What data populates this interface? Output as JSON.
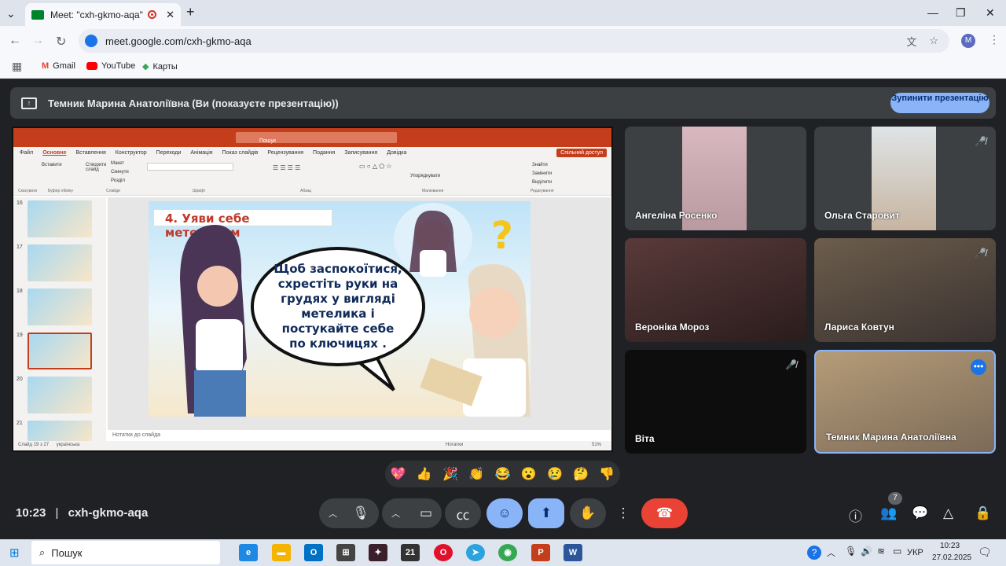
{
  "browser": {
    "tab_title": "Meet: \"cxh-gkmo-aqa\"",
    "new_tab": "+",
    "url": "meet.google.com/cxh-gkmo-aqa",
    "profile": "M",
    "bookmarks": [
      {
        "label": "Gmail"
      },
      {
        "label": "YouTube"
      },
      {
        "label": "Карты"
      }
    ]
  },
  "presenting": {
    "banner": "Темник Марина Анатоліївна (Ви (показуєте презентацію))",
    "stop_button": "Зупинити презентацію"
  },
  "powerpoint": {
    "search": "Пошук",
    "tabs": [
      "Файл",
      "Основне",
      "Вставлення",
      "Конструктор",
      "Переходи",
      "Анімація",
      "Показ слайдів",
      "Рецензування",
      "Подання",
      "Записування",
      "Довідка"
    ],
    "share": "Спільний доступ",
    "ribbon_groups": [
      "Скасувати",
      "Буфер обміну",
      "Слайди",
      "Шрифт",
      "Абзац",
      "Малювання",
      "Редагування"
    ],
    "ribbon_buttons": [
      "Вставити",
      "Створити слайд",
      "Макет",
      "Скинути",
      "Розділ",
      "Упорядкувати",
      "Знайти",
      "Замінити",
      "Виділити"
    ],
    "slide_numbers": [
      "16",
      "17",
      "18",
      "19",
      "20",
      "21"
    ],
    "slide": {
      "title": "4. Уяви себе метеликом",
      "bubble_text": "Щоб заспокоїтися, схрестіть руки на грудях у вигляді метелика і постукайте себе по ключицях ."
    },
    "notes_placeholder": "Нотатки до слайда",
    "status_left": "Слайд 19 з 27",
    "status_lang": "українська",
    "status_notes": "Нотатки",
    "zoom": "51%"
  },
  "participants": [
    {
      "name": "Ангеліна Росенко",
      "muted": false
    },
    {
      "name": "Ольга Старовит",
      "muted": true
    },
    {
      "name": "Вероніка Мороз",
      "muted": false
    },
    {
      "name": "Лариса Ковтун",
      "muted": true
    },
    {
      "name": "Віта",
      "muted": true
    },
    {
      "name": "Темник Марина Анатоліївна",
      "muted": false
    }
  ],
  "reactions": [
    "💖",
    "👍",
    "🎉",
    "👏",
    "😂",
    "😮",
    "😢",
    "🤔",
    "👎"
  ],
  "meeting": {
    "time": "10:23",
    "separator": "|",
    "code": "cxh-gkmo-aqa",
    "people_count": "7"
  },
  "taskbar": {
    "search": "Пошук",
    "lang": "УКР",
    "time": "10:23",
    "date": "27.02.2025"
  },
  "colors": {
    "meet_bg": "#202124",
    "accent_blue": "#8ab4f8",
    "end_call_red": "#ea4335",
    "ppt_orange": "#c43e1c"
  }
}
